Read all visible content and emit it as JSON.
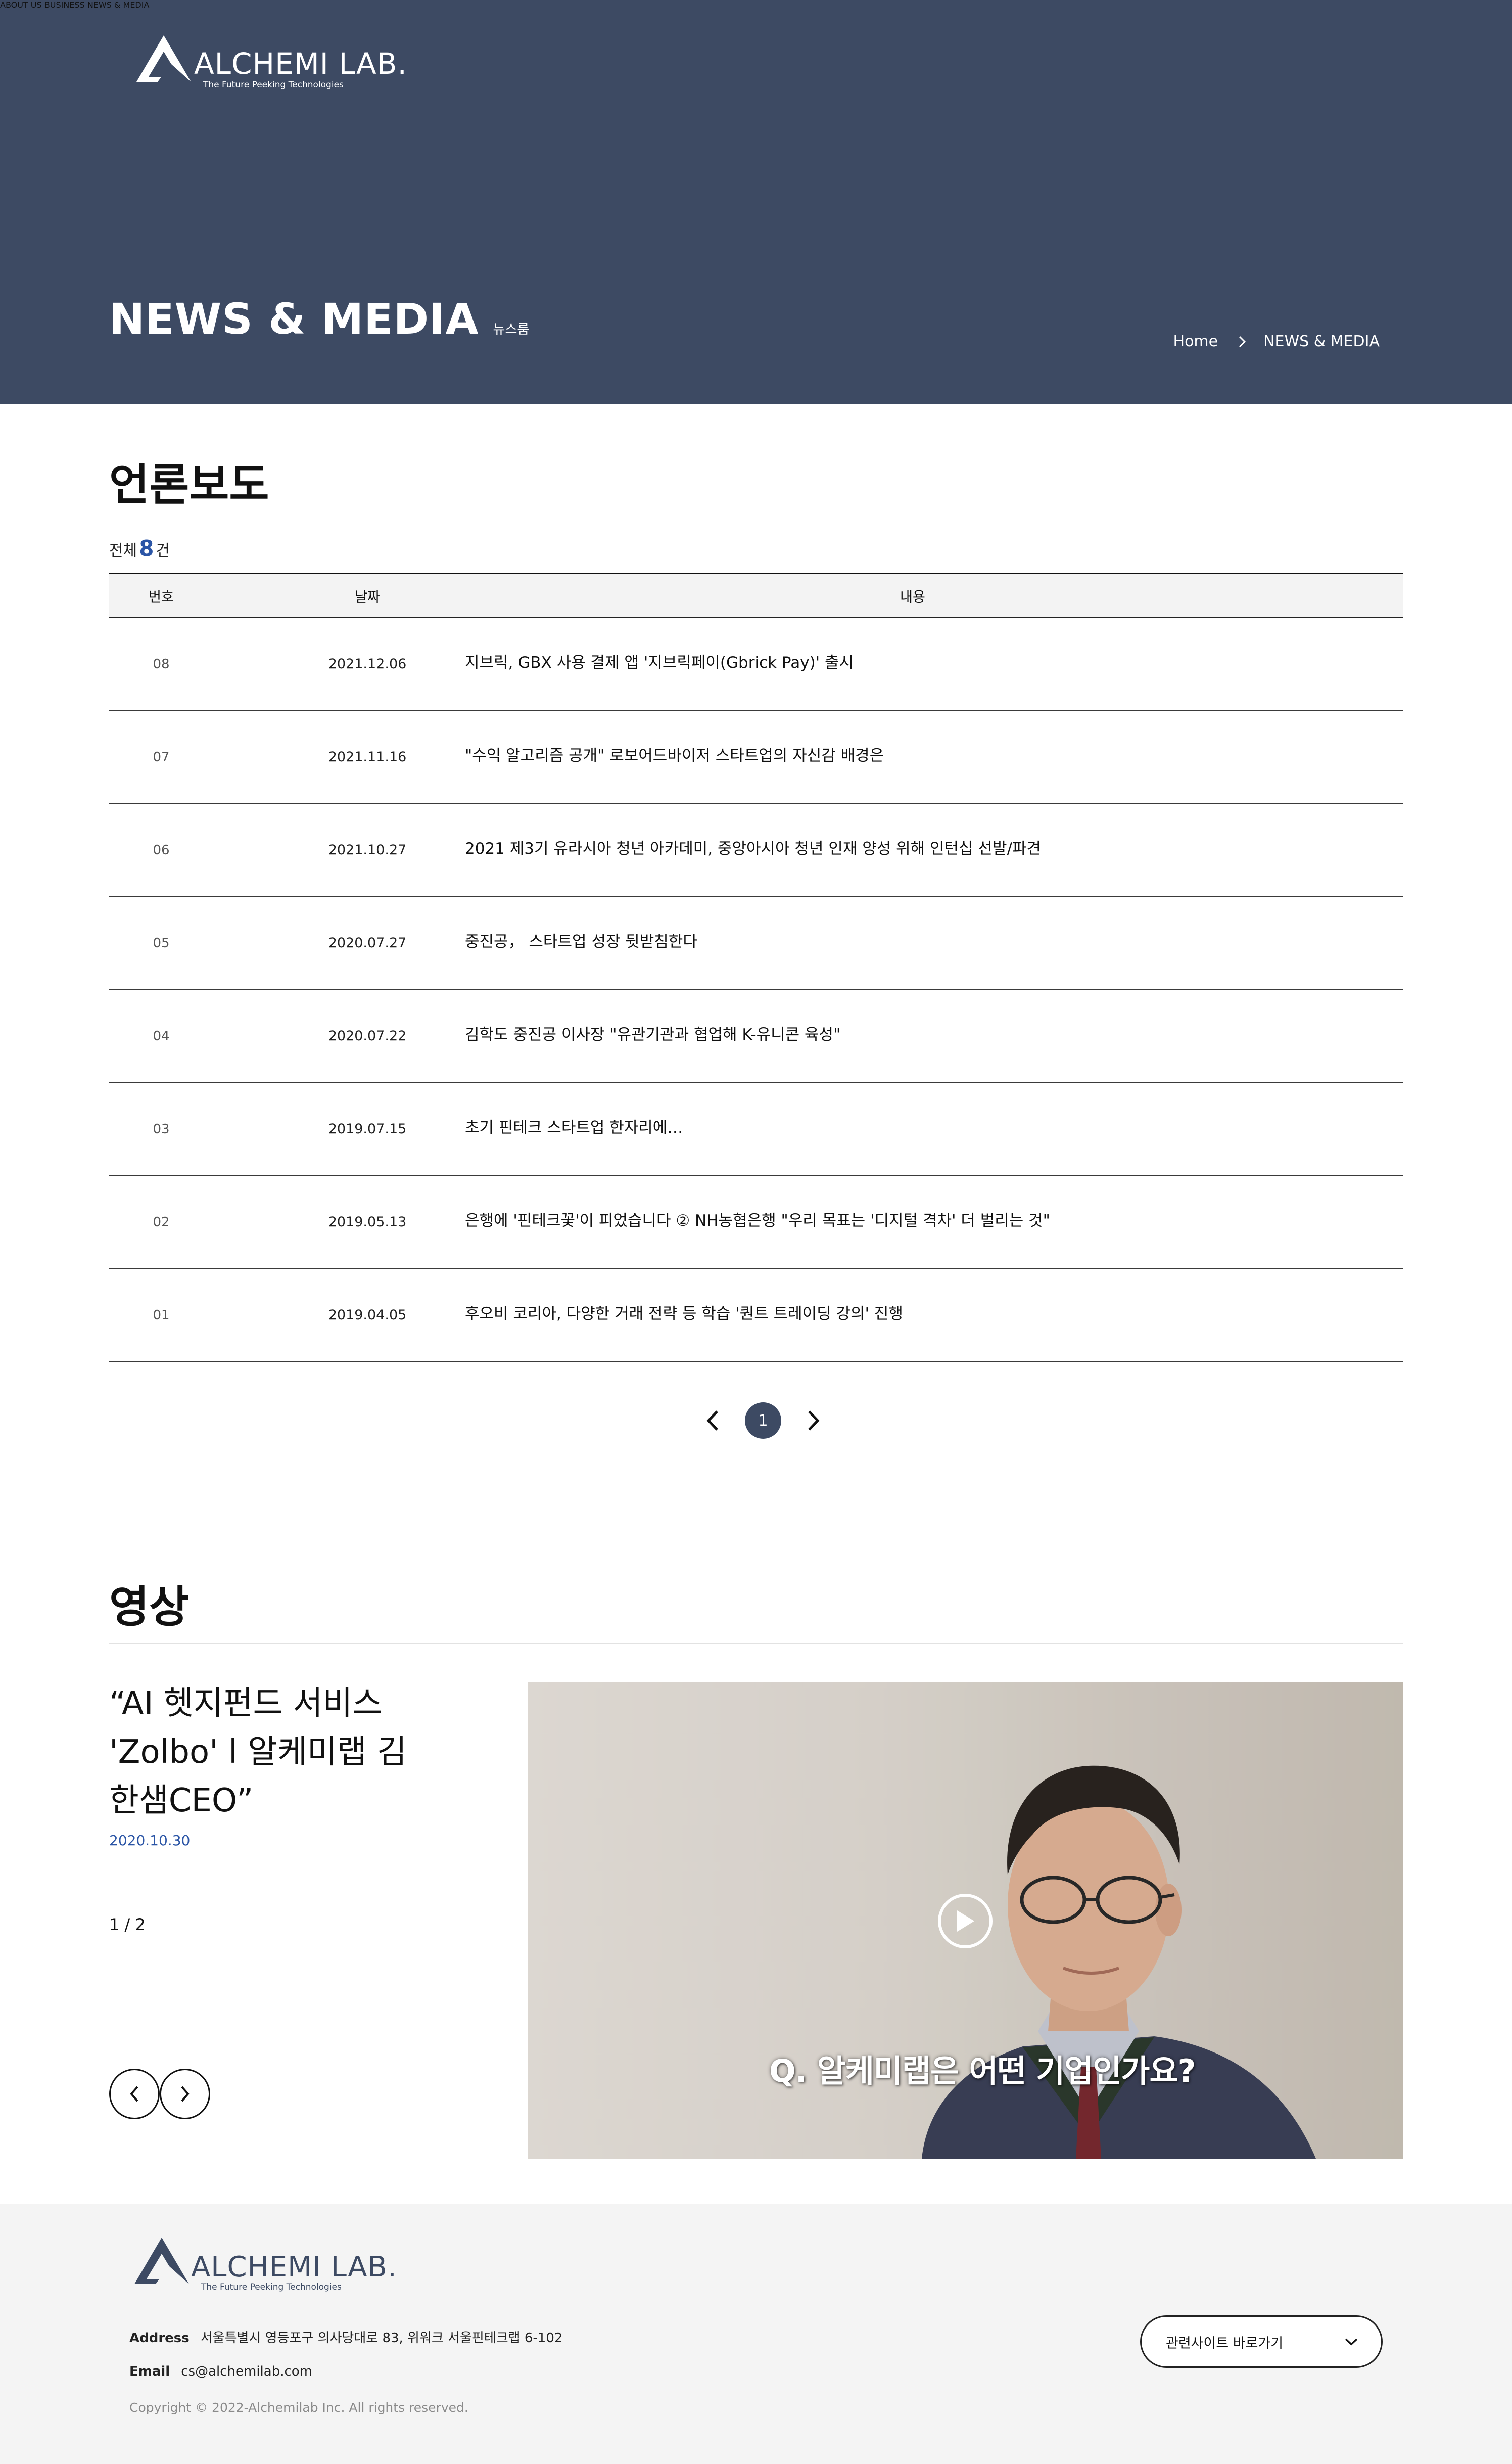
{
  "brand": {
    "name": "ALCHEMI LAB.",
    "tagline": "The Future Peeking Technologies",
    "primary_color": "#3d4a63",
    "accent_color": "#2b55a6"
  },
  "nav": {
    "items": [
      "ABOUT US",
      "BUSINESS",
      "NEWS & MEDIA"
    ]
  },
  "hero": {
    "title": "NEWS & MEDIA",
    "subtitle": "뉴스룸",
    "breadcrumb": [
      "Home",
      "NEWS & MEDIA"
    ]
  },
  "press": {
    "section_title": "언론보도",
    "count_prefix": "전체",
    "count": "8",
    "count_suffix": "건",
    "columns": [
      "번호",
      "날짜",
      "내용"
    ],
    "rows": [
      {
        "no": "08",
        "date": "2021.12.06",
        "title": "지브릭, GBX 사용 결제 앱 '지브릭페이(Gbrick Pay)' 출시"
      },
      {
        "no": "07",
        "date": "2021.11.16",
        "title": "\"수익 알고리즘 공개\" 로보어드바이저 스타트업의 자신감 배경은"
      },
      {
        "no": "06",
        "date": "2021.10.27",
        "title": "2021 제3기 유라시아 청년 아카데미, 중앙아시아 청년 인재 양성 위해 인턴십 선발/파견"
      },
      {
        "no": "05",
        "date": "2020.07.27",
        "title": "중진공， 스타트업 성장 뒷받침한다"
      },
      {
        "no": "04",
        "date": "2020.07.22",
        "title": "김학도 중진공 이사장 \"유관기관과 협업해 K-유니콘 육성\""
      },
      {
        "no": "03",
        "date": "2019.07.15",
        "title": "초기 핀테크 스타트업 한자리에…"
      },
      {
        "no": "02",
        "date": "2019.05.13",
        "title": "은행에 '핀테크꽃'이 피었습니다 ② NH농협은행 \"우리 목표는 '디지털 격차' 더 벌리는 것\""
      },
      {
        "no": "01",
        "date": "2019.04.05",
        "title": "후오비 코리아, 다양한 거래 전략 등 학습 '퀀트 트레이딩 강의' 진행"
      }
    ],
    "pagination": {
      "current": "1"
    }
  },
  "video": {
    "section_title": "영상",
    "headline": "“AI 헷지펀드 서비스 'Zolbo' l 알케미랩 김한샘CEO”",
    "date": "2020.10.30",
    "counter": "1 / 2",
    "caption": "Q. 알케미랩은 어떤 기업인가요?"
  },
  "footer": {
    "address_label": "Address",
    "address": "서울특별시 영등포구 의사당대로 83, 위워크 서울핀테크랩 6-102",
    "email_label": "Email",
    "email": "cs@alchemilab.com",
    "copyright": "Copyright © 2022-Alchemilab Inc. All rights reserved.",
    "site_select": "관련사이트 바로가기"
  }
}
